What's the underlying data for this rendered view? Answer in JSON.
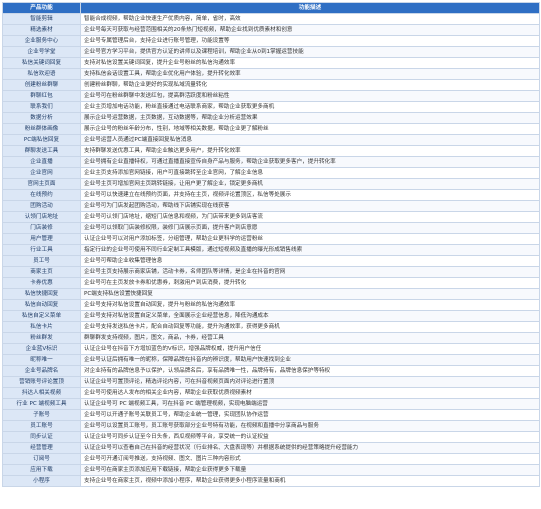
{
  "table": {
    "headers": [
      "产品功能",
      "功能描述"
    ],
    "rows": [
      [
        "智能剪辑",
        "智能合成视频，帮助企业快速生产优质内容，简单，省时，高效"
      ],
      [
        "精选素材",
        "企业号每天可获取与经营范围相关的20条热门短视频，帮助企业找到优质素材和创意"
      ],
      [
        "企业服务中心",
        "企业号专属管理后台，支持企业进行账号管理，功能设置等"
      ],
      [
        "企业号学堂",
        "企业号官方学习平台，提供官方认证的讲师以及课程培训，帮助企业从0到1掌握运营技能"
      ],
      [
        "私信关键词回复",
        "支持对私信设置关键词回复，提升企业号粉丝的私信沟通效率"
      ],
      [
        "私信欢迎语",
        "支持私信会话设置工具，帮助企业优化用户体验，提升转化效率"
      ],
      [
        "创建粉丝群聊",
        "创建粉丝群聊，帮助企业更好的实现私域流量转化"
      ],
      [
        "群聊红包",
        "企业号可在粉丝群聊中发送红包，提高群活跃度和粉丝粘性"
      ],
      [
        "联系我们",
        "企业主页增加电话功能，粉丝直接通过电话联系商家，帮助企业获取更多商机"
      ],
      [
        "数据分析",
        "展示企业号运营数据，主页数据，互动数据等，帮助企业分析运营效果"
      ],
      [
        "粉丝群体画像",
        "展示企业号的粉丝年龄分布，性别，地域等相关数据，帮助企业更了解粉丝"
      ],
      [
        "PC端私信回复",
        "企业号运营人员通过PC端直接回复私信消息"
      ],
      [
        "群聊发送工具",
        "支持群聊发送优惠工具，帮助企业触达更多用户，提升转化效率"
      ],
      [
        "企业直播",
        "企业号拥有企业直播特权，可通过直播直接宣传自身产品与服务，帮助企业获取更多客户，提升转化率"
      ],
      [
        "企业官网",
        "企业主页支持添加官网链接，用户可直接跳转至企业官网，了解企业信息"
      ],
      [
        "官网主页面",
        "企业号主页可增加官网主页跳转链接，让用户更了解企业，锁定更多商机"
      ],
      [
        "在线预约",
        "企业号可以快速建立在线预约页面，并支持在主页，视频评论置顶区，私信等处展示"
      ],
      [
        "团购活动",
        "企业号可为门店发起团购活动，帮助线下店铺实现在线获客"
      ],
      [
        "认领门店地址",
        "企业号可认领门店地址，缩短门店信息和视频，为门店带来更多到店客流"
      ],
      [
        "门店装修",
        "企业号可以领取门店装修权限，装修门店展示页面，提升客户到店意愿"
      ],
      [
        "用户管理",
        "认证企业号可以对用户添加标签，分组管理，帮助企业更科学的运营粉丝"
      ],
      [
        "行业工具",
        "指定行业的企业号可使用不同行业定制工具模版，通过短视频及直播的曝光形成销售线索"
      ],
      [
        "员工号",
        "企业号可帮助企业收集管理信息"
      ],
      [
        "商家主页",
        "企业号主页支持展示商家店铺，活动卡券，名师团队等详情，是企业在抖音的官网"
      ],
      [
        "卡券优惠",
        "企业号可在主页发放卡券和优惠券，刺激用户到店消费，提升转化"
      ],
      [
        "私信快捷回复",
        "PC端支持私信设置快捷回复"
      ],
      [
        "私信自动回复",
        "企业号支持对私信设置自动回复，提升与粉丝的私信沟通效率"
      ],
      [
        "私信自定义菜单",
        "企业号支持对私信设置自定义菜单，全面展示企业经营信息，降低沟通成本"
      ],
      [
        "私信卡片",
        "企业号支持发送私信卡片，配合自动回复等功能，提升沟通效率，获得更多商机"
      ],
      [
        "粉丝群发",
        "群聊群发支持视频，图片，图文，商品，卡券，经营工具"
      ],
      [
        "企业蓝V标识",
        "认证企业号在抖音下方增加蓝色的V标识，增强品牌权威，提升用户信任"
      ],
      [
        "昵称唯一",
        "企业号认证后拥有唯一的昵称，保障品牌在抖音内的辨识度，帮助用户快速找到企业"
      ],
      [
        "企业号品牌名",
        "对企业持有的品牌信息予以保护，认领品牌名后，享有品牌唯一性，品牌持有，品牌信息保护等特权"
      ],
      [
        "营销账号评论置顶",
        "认证企业号可置顶评论，精选评论内容，可在抖音视频页面内对评论进行置顶"
      ],
      [
        "抖达人相关视频",
        "企业号可使用达人发布的相关企业内容，帮助企业获取优质视频素材"
      ],
      [
        "行业 PC 端视频工具",
        "认证企业号可 PC 端视频工具，可在抖音 PC 端管理视频，实现电脑端运营"
      ],
      [
        "子账号",
        "企业号可以开通子账号关联员工号，帮助企业统一管理，实现团队协作运营"
      ],
      [
        "员工账号",
        "企业号可以设置员工账号，员工账号获取部分企业号特有功能，在视频和直播中分享商品与服务"
      ],
      [
        "同步认证",
        "认证企业号可同步认证至今日头条，西瓜视频等平台，享受统一的认证权益"
      ],
      [
        "经营管理",
        "认证企业号可以查看自己在抖音的经营状况（行业排名、大盘表现等）并根据系统提供的经营策略提升经营能力"
      ],
      [
        "订阅号",
        "企业号可开通订阅号推送，支持视频、图文、图片三种内容形式"
      ],
      [
        "应用下载",
        "企业号可在商家主页添加应用下载链接，帮助企业获得更多下载量"
      ],
      [
        "小程序",
        "支持企业号在商家主页，视频中添加小程序，帮助企业获得更多小程序流量和商机"
      ]
    ]
  }
}
